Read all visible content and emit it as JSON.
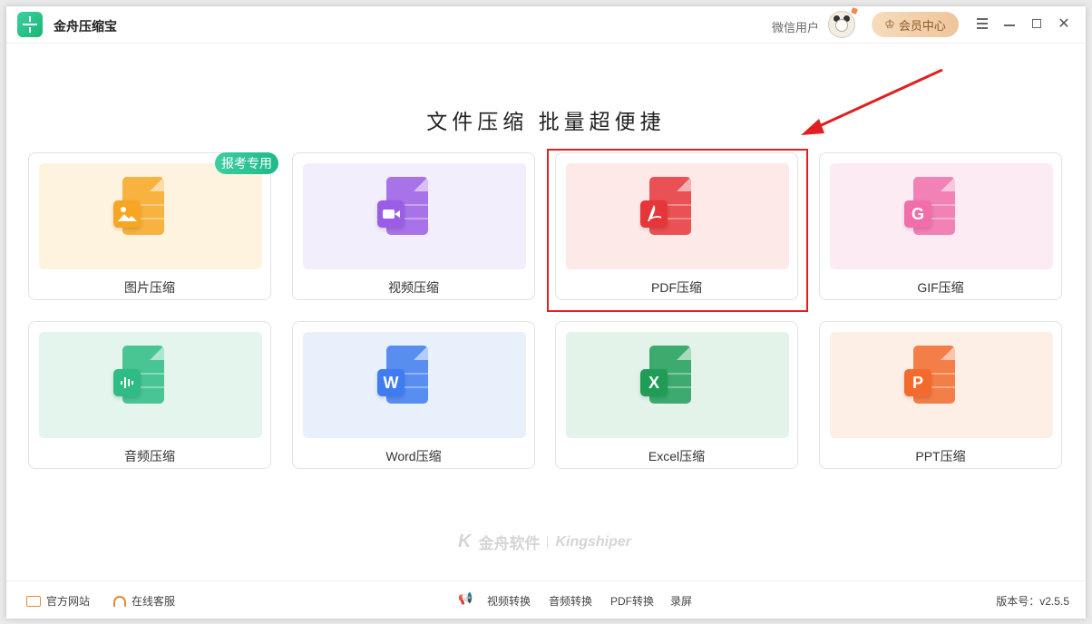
{
  "app": {
    "title": "金舟压缩宝"
  },
  "header": {
    "user_name": "微信用户",
    "vip_label": "会员中心"
  },
  "headline": "文件压缩  批量超便捷",
  "tag": "报考专用",
  "cards": [
    {
      "label": "图片压缩",
      "icon": "image-file-icon",
      "tile_color": "#fdf3df",
      "accent": "#f6a623"
    },
    {
      "label": "视频压缩",
      "icon": "video-file-icon",
      "tile_color": "#f2eefc",
      "accent": "#9b5de5"
    },
    {
      "label": "PDF压缩",
      "icon": "pdf-file-icon",
      "tile_color": "#fde9e8",
      "accent": "#e5363a"
    },
    {
      "label": "GIF压缩",
      "icon": "gif-file-icon",
      "tile_color": "#fdebf4",
      "accent": "#f06ea9"
    },
    {
      "label": "音频压缩",
      "icon": "audio-file-icon",
      "tile_color": "#e4f5ee",
      "accent": "#2ebc84"
    },
    {
      "label": "Word压缩",
      "icon": "word-file-icon",
      "tile_color": "#e8f0fc",
      "accent": "#3f7cef"
    },
    {
      "label": "Excel压缩",
      "icon": "excel-file-icon",
      "tile_color": "#e3f3ea",
      "accent": "#1f9d57"
    },
    {
      "label": "PPT压缩",
      "icon": "ppt-file-icon",
      "tile_color": "#fdeee6",
      "accent": "#f26a2c"
    }
  ],
  "badge_glyphs": [
    "",
    "",
    "",
    "G",
    "",
    "W",
    "X",
    "P"
  ],
  "brand": {
    "cn": "金舟软件",
    "en": "Kingshiper"
  },
  "footer": {
    "website": "官方网站",
    "support": "在线客服",
    "links": [
      "视频转换",
      "音频转换",
      "PDF转换",
      "录屏"
    ],
    "version": "版本号：v2.5.5"
  },
  "colors": {
    "highlight": "#e02020",
    "brand_green": "#1fb88a"
  }
}
